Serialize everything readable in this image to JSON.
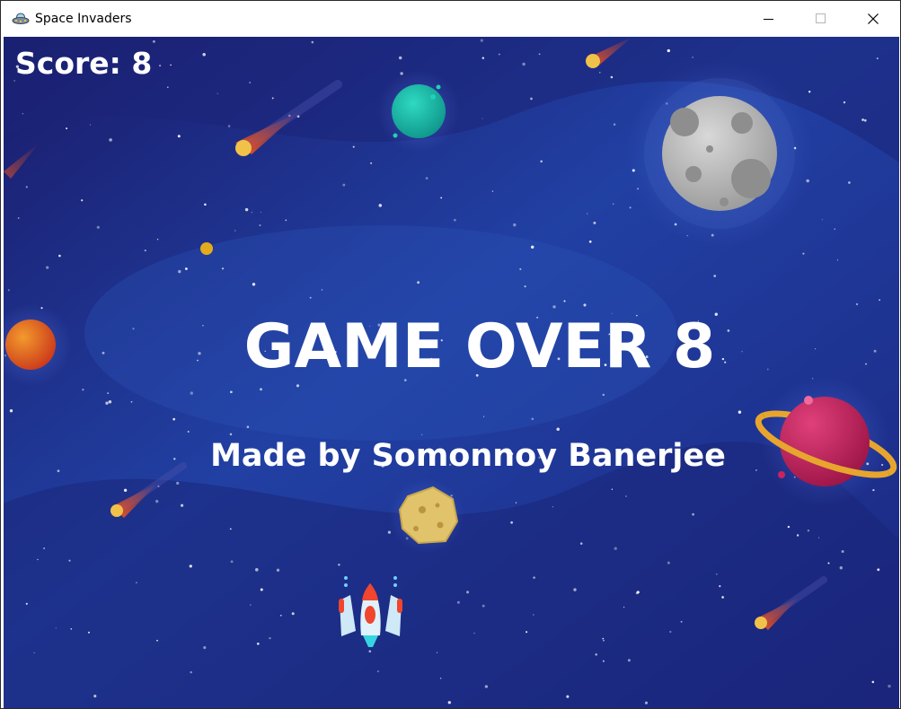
{
  "window": {
    "title": "Space Invaders",
    "icon": "ufo-icon",
    "controls": [
      "minimize-icon",
      "maximize-icon",
      "close-icon"
    ]
  },
  "hud": {
    "score_label": "Score: 8"
  },
  "screen": {
    "game_over_text": "GAME OVER 8",
    "credit_text": "Made by Somonnoy Banerjee"
  },
  "sprites": {
    "player": "spaceship-icon",
    "objects": [
      "comet-icon",
      "teal-planet-icon",
      "moon-icon",
      "orange-planet-icon",
      "ringed-planet-icon",
      "asteroid-icon",
      "small-yellow-planet-icon"
    ]
  },
  "colors": {
    "background_deep": "#171a66",
    "background_mid": "#243a9e",
    "text": "#ffffff",
    "ringed_planet": "#c9245f",
    "ring": "#e7a52d",
    "teal_planet": "#19b8a5",
    "orange_planet": "#e0561c",
    "ship_accent": "#f0452e"
  }
}
